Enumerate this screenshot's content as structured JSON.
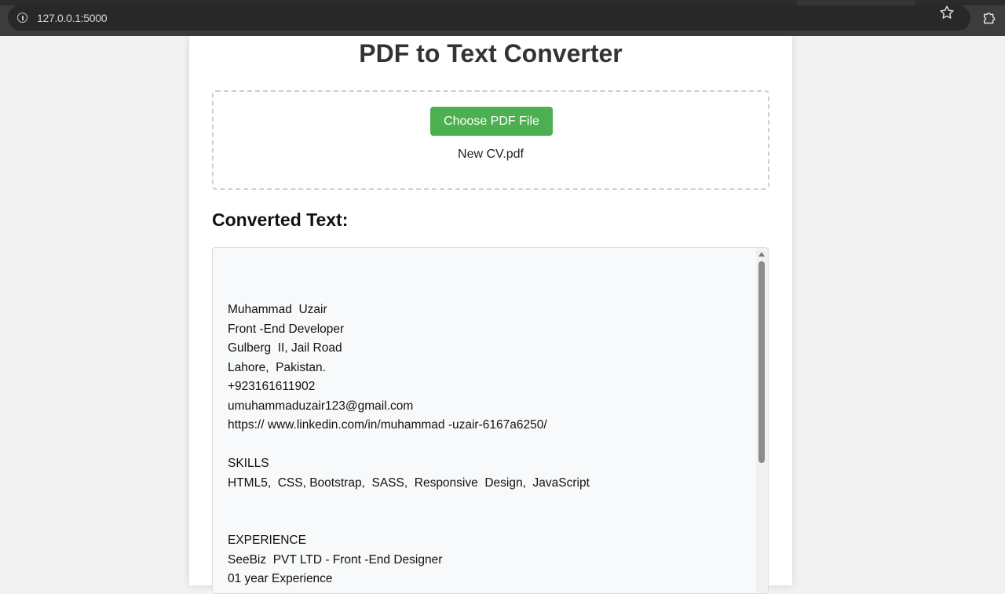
{
  "browser": {
    "url": "127.0.0.1:5000",
    "info_icon": "info-icon",
    "bookmark_icon": "star-icon",
    "extensions_icon": "puzzle-icon"
  },
  "page": {
    "title": "PDF to Text Converter",
    "upload": {
      "button_label": "Choose PDF File",
      "file_name": "New CV.pdf",
      "button_color": "#4caf50"
    },
    "output": {
      "heading": "Converted Text:",
      "lines": [
        "",
        "",
        "",
        "Muhammad  Uzair",
        "Front -End Developer",
        "Gulberg  II, Jail Road",
        "Lahore,  Pakistan.",
        "+923161611902",
        "umuhammaduzair123@gmail.com",
        "https:// www.linkedin.com/in/muhammad -uzair-6167a6250/",
        "",
        "SKILLS",
        "HTML5,  CSS, Bootstrap,  SASS,  Responsive  Design,  JavaScript",
        "",
        "",
        "EXPERIENCE",
        "SeeBiz  PVT LTD - Front -End Designer",
        "01 year Experience"
      ]
    }
  }
}
